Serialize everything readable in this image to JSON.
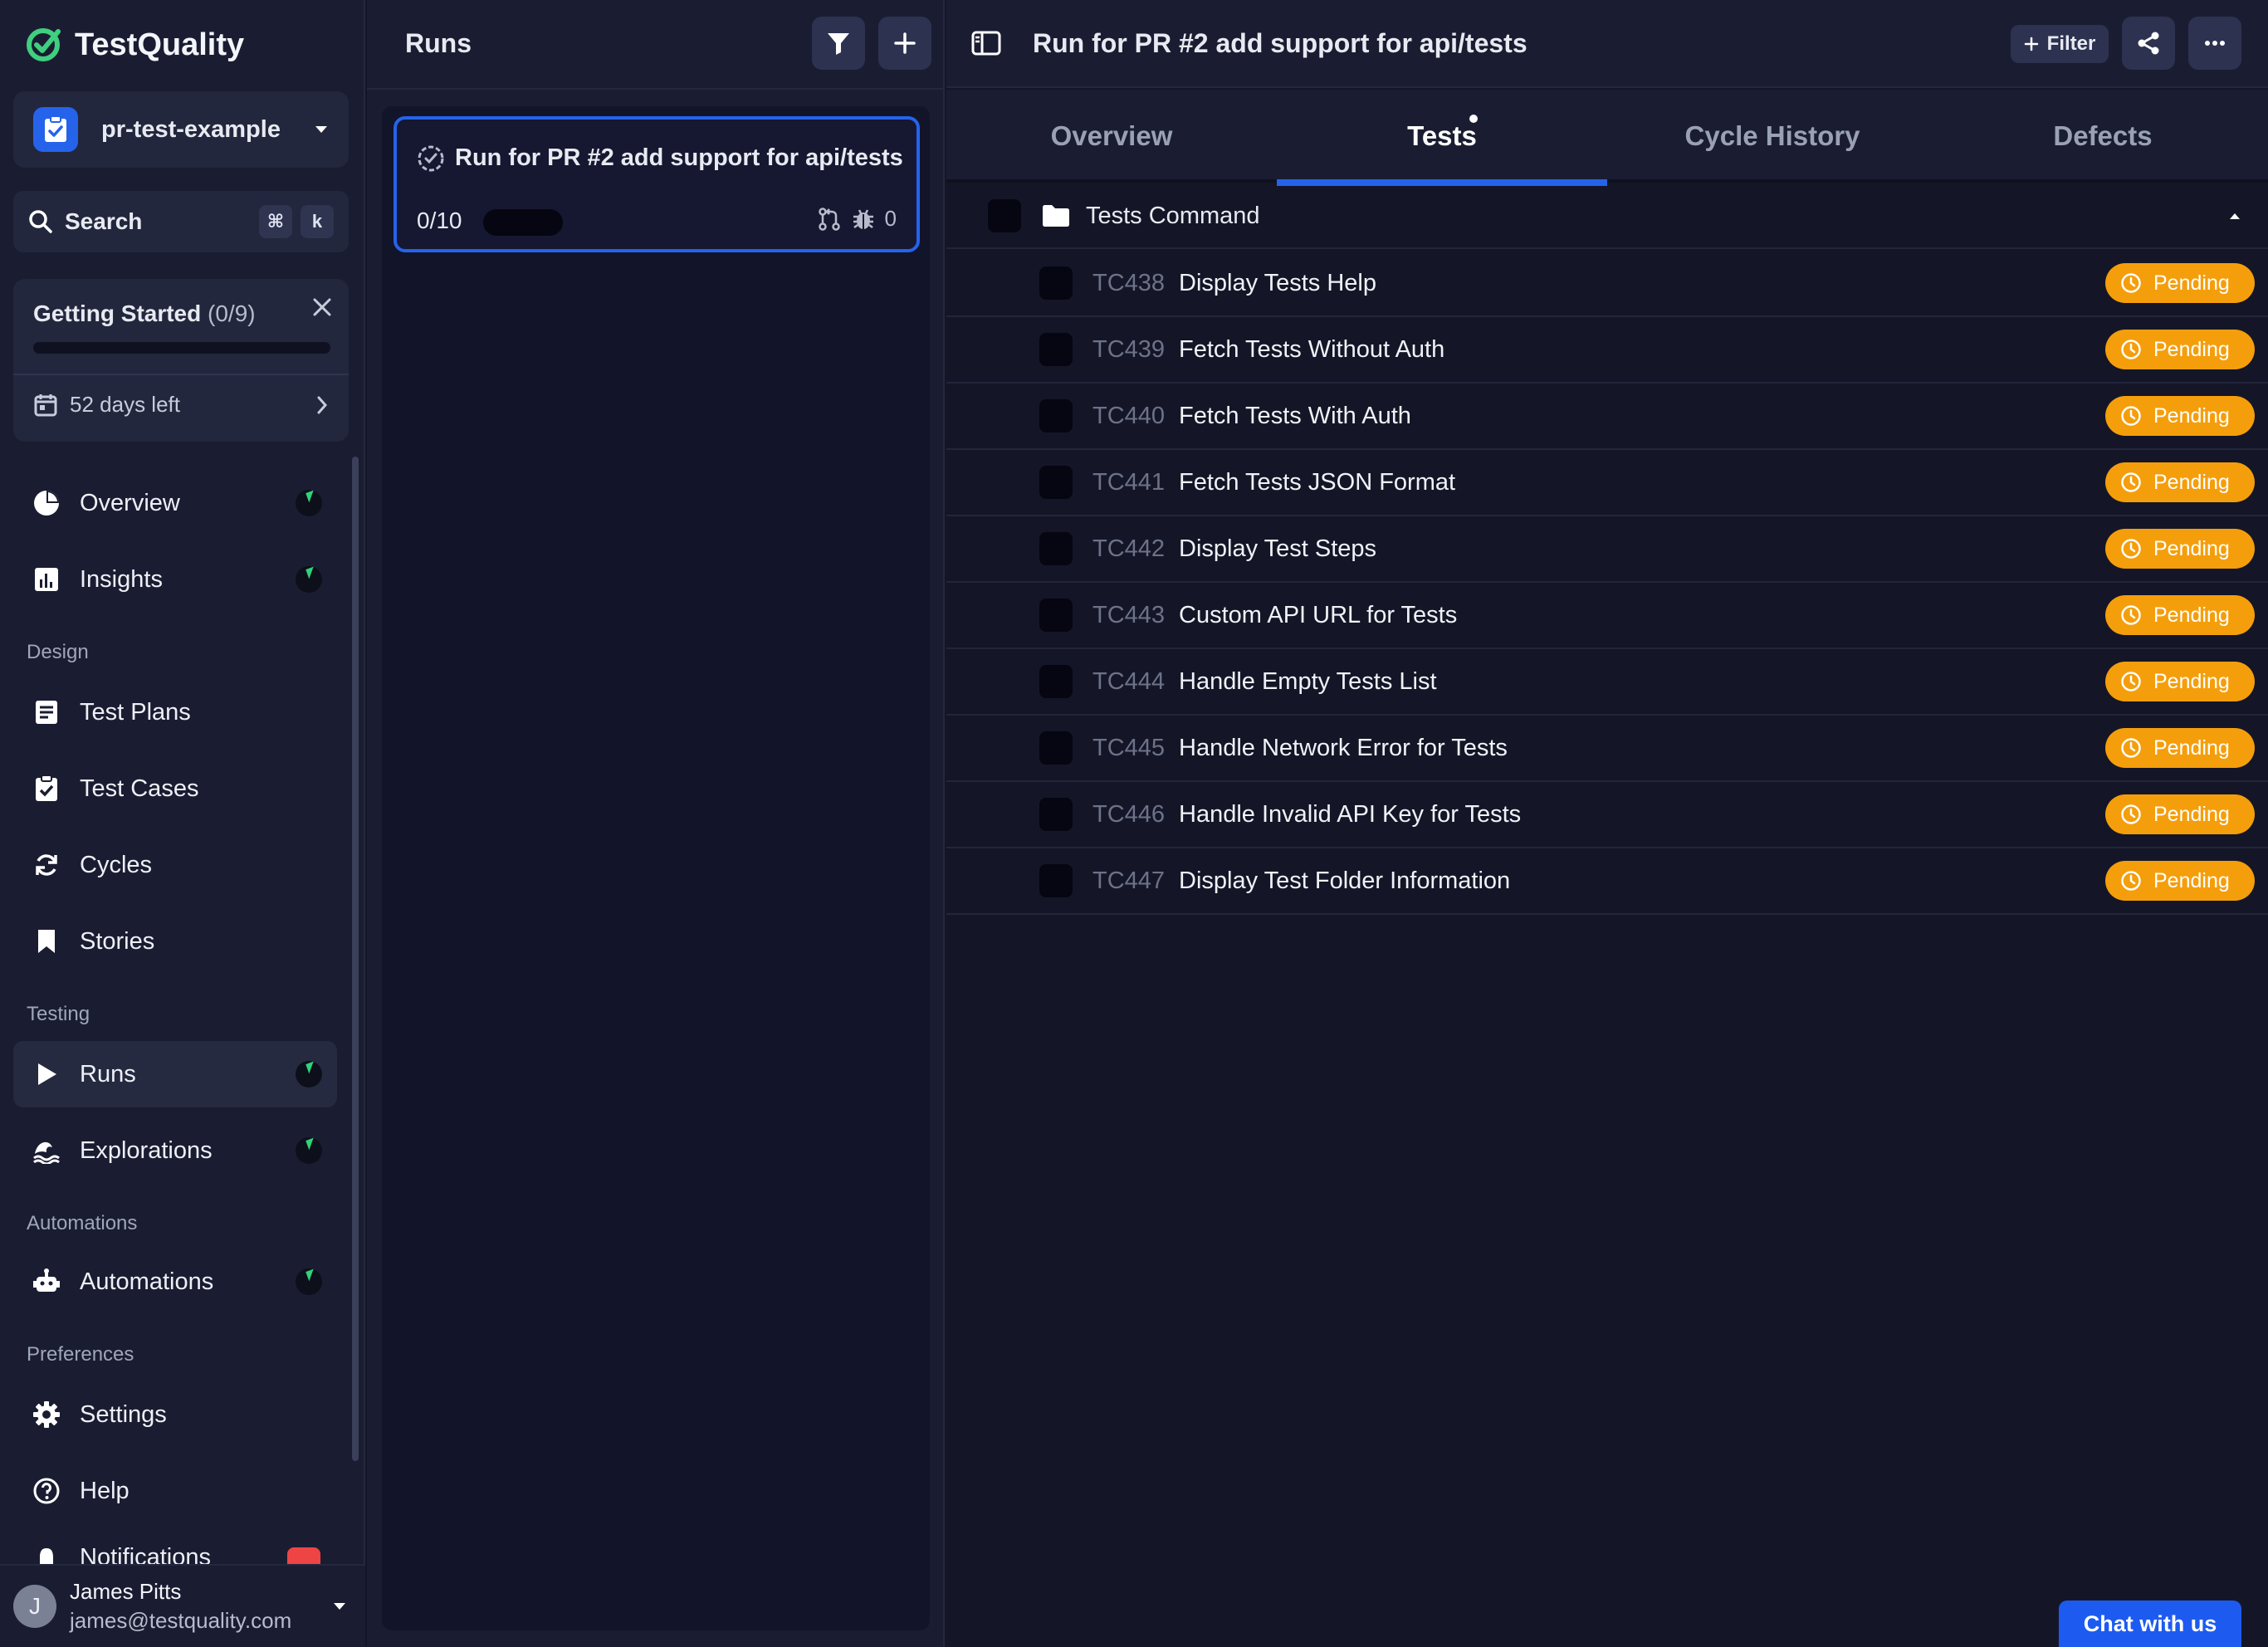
{
  "brand": {
    "name": "TestQuality",
    "accent": "#2563eb"
  },
  "project": {
    "name": "pr-test-example"
  },
  "search": {
    "label": "Search",
    "shortcut_mod": "⌘",
    "shortcut_key": "k"
  },
  "getting_started": {
    "title": "Getting Started",
    "count": "(0/9)",
    "days_left": "52 days left",
    "progress": 0
  },
  "nav": {
    "overview": "Overview",
    "insights": "Insights",
    "design_section": "Design",
    "test_plans": "Test Plans",
    "test_cases": "Test Cases",
    "cycles": "Cycles",
    "stories": "Stories",
    "testing_section": "Testing",
    "runs": "Runs",
    "explorations": "Explorations",
    "automations_section": "Automations",
    "automations": "Automations",
    "preferences_section": "Preferences",
    "settings": "Settings",
    "help": "Help",
    "notifications": "Notifications"
  },
  "user": {
    "name": "James Pitts",
    "email": "james@testquality.com",
    "initial": "J"
  },
  "runs_panel": {
    "title": "Runs",
    "run": {
      "title": "Run for PR #2 add support for api/tests",
      "progress_text": "0/10",
      "defects_count": "0",
      "progress": 0
    }
  },
  "main": {
    "title": "Run for PR #2 add support for api/tests",
    "filter_label": "Filter",
    "tabs": [
      "Overview",
      "Tests",
      "Cycle History",
      "Defects"
    ],
    "active_tab": "Tests",
    "folder": "Tests Command",
    "tests": [
      {
        "key": "TC438",
        "name": "Display Tests Help",
        "status": "Pending"
      },
      {
        "key": "TC439",
        "name": "Fetch Tests Without Auth",
        "status": "Pending"
      },
      {
        "key": "TC440",
        "name": "Fetch Tests With Auth",
        "status": "Pending"
      },
      {
        "key": "TC441",
        "name": "Fetch Tests JSON Format",
        "status": "Pending"
      },
      {
        "key": "TC442",
        "name": "Display Test Steps",
        "status": "Pending"
      },
      {
        "key": "TC443",
        "name": "Custom API URL for Tests",
        "status": "Pending"
      },
      {
        "key": "TC444",
        "name": "Handle Empty Tests List",
        "status": "Pending"
      },
      {
        "key": "TC445",
        "name": "Handle Network Error for Tests",
        "status": "Pending"
      },
      {
        "key": "TC446",
        "name": "Handle Invalid API Key for Tests",
        "status": "Pending"
      },
      {
        "key": "TC447",
        "name": "Display Test Folder Information",
        "status": "Pending"
      }
    ],
    "pending_color": "#f59e0b"
  },
  "chat": {
    "label": "Chat with us"
  }
}
